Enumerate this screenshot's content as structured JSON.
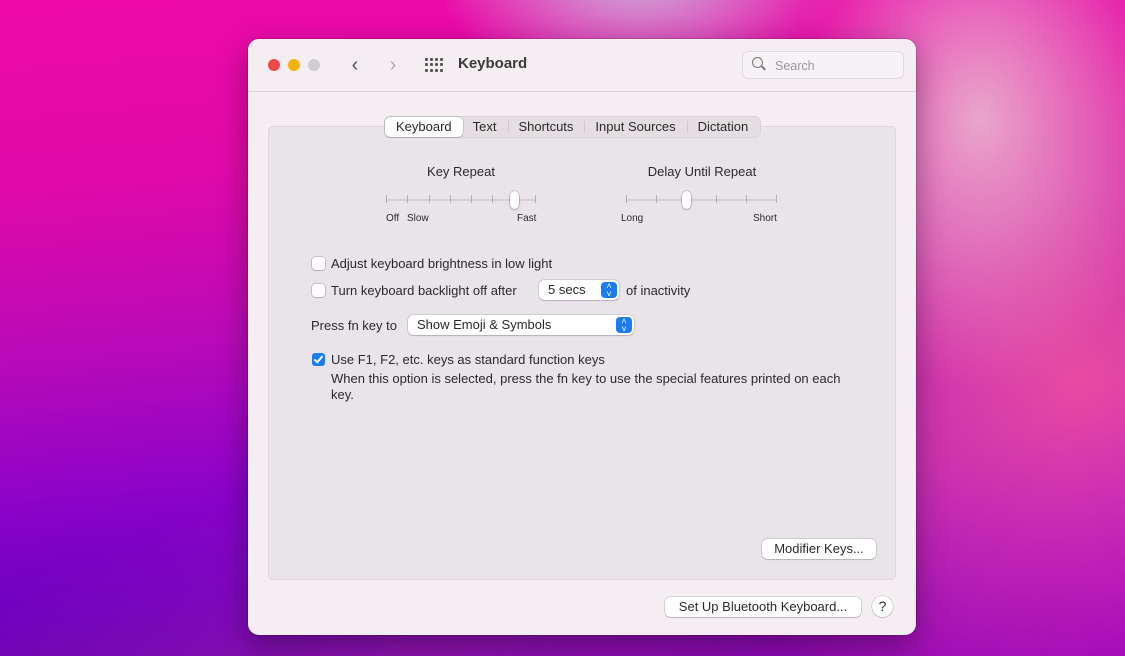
{
  "window": {
    "title": "Keyboard",
    "search_placeholder": "Search",
    "search_value": ""
  },
  "tabs": [
    {
      "label": "Keyboard",
      "active": true
    },
    {
      "label": "Text",
      "active": false
    },
    {
      "label": "Shortcuts",
      "active": false
    },
    {
      "label": "Input Sources",
      "active": false
    },
    {
      "label": "Dictation",
      "active": false
    }
  ],
  "sliders": {
    "key_repeat": {
      "title": "Key Repeat",
      "ticks": 8,
      "value_index": 6,
      "labels": {
        "off": "Off",
        "slow": "Slow",
        "fast": "Fast"
      }
    },
    "delay_until_repeat": {
      "title": "Delay Until Repeat",
      "ticks": 6,
      "value_index": 2,
      "labels": {
        "long": "Long",
        "short": "Short"
      }
    }
  },
  "options": {
    "adjust_brightness": {
      "label": "Adjust keyboard brightness in low light",
      "checked": false
    },
    "backlight_off": {
      "label": "Turn keyboard backlight off after",
      "checked": false,
      "value": "5 secs",
      "suffix": "of inactivity"
    },
    "fn_key": {
      "label": "Press fn key to",
      "value": "Show Emoji & Symbols"
    },
    "function_keys": {
      "label": "Use F1, F2, etc. keys as standard function keys",
      "checked": true,
      "description": "When this option is selected, press the fn key to use the special features printed on each key."
    }
  },
  "buttons": {
    "modifier_keys": "Modifier Keys...",
    "bluetooth": "Set Up Bluetooth Keyboard...",
    "help": "?"
  },
  "colors": {
    "accent": "#1b7cf2",
    "close": "#ee4a48",
    "minimize": "#f3b20c",
    "zoom_disabled": "#d0cdd0"
  }
}
